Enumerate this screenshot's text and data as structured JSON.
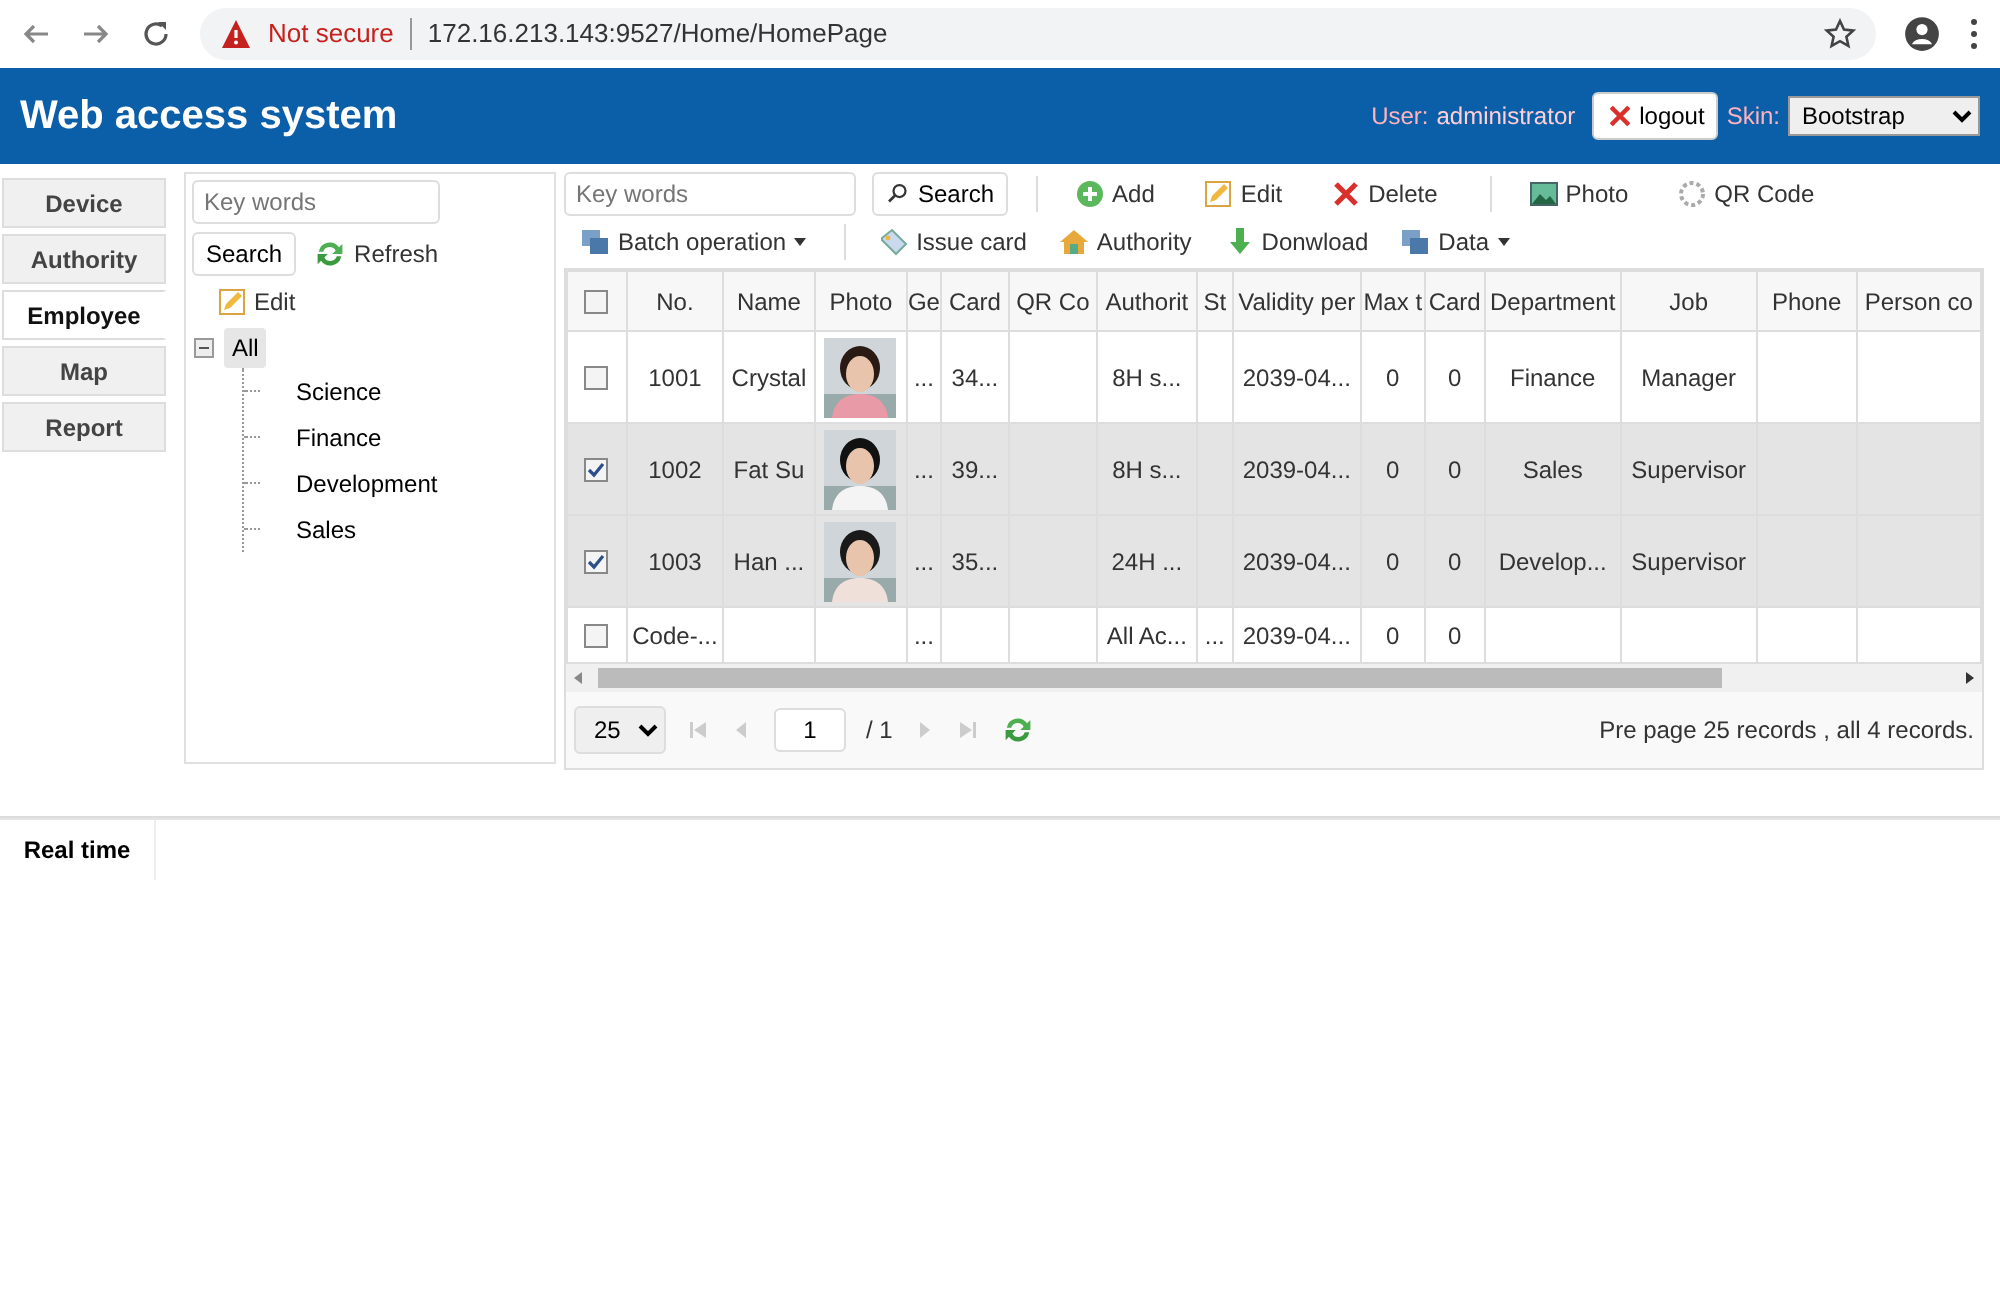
{
  "browser": {
    "security": "Not secure",
    "url": "172.16.213.143:9527/Home/HomePage"
  },
  "header": {
    "title": "Web access system",
    "user_label": "User:",
    "user": "administrator",
    "logout": "logout",
    "skin_label": "Skin:",
    "skin": "Bootstrap"
  },
  "nav_tabs": [
    {
      "label": "Device",
      "selected": false
    },
    {
      "label": "Authority",
      "selected": false
    },
    {
      "label": "Employee",
      "selected": true
    },
    {
      "label": "Map",
      "selected": false
    },
    {
      "label": "Report",
      "selected": false
    }
  ],
  "tree_panel": {
    "search": {
      "placeholder": "Key words"
    },
    "search_button": "Search",
    "refresh": "Refresh",
    "edit": "Edit",
    "tree": [
      {
        "label": "All",
        "expanded": true,
        "selected": true,
        "children": [
          {
            "label": "Science",
            "selected": false
          },
          {
            "label": "Finance",
            "selected": false
          },
          {
            "label": "Development",
            "selected": false
          },
          {
            "label": "Sales",
            "selected": false
          }
        ]
      }
    ]
  },
  "toolbar": {
    "search": {
      "placeholder": "Key words"
    },
    "search_button": "Search",
    "row_1": [
      {
        "label": "Add"
      },
      {
        "label": "Edit"
      },
      {
        "label": "Delete"
      },
      {
        "label": "Photo"
      },
      {
        "label": "QR Code"
      }
    ],
    "row_2": [
      {
        "label": "Batch operation",
        "dropdown": true
      },
      {
        "label": "Issue card",
        "dropdown": false
      },
      {
        "label": "Authority",
        "dropdown": false
      },
      {
        "label": "Donwload",
        "dropdown": false
      },
      {
        "label": "Data",
        "dropdown": true
      }
    ]
  },
  "table": {
    "all_selected": false,
    "columns": [
      "No.",
      "Name",
      "Photo",
      "Ge",
      "Card",
      "QR Co",
      "Authorit",
      "St",
      "Validity per",
      "Max t",
      "Card",
      "Department",
      "Job",
      "Phone",
      "Person co"
    ],
    "rows": [
      {
        "selected": false,
        "cells": [
          "1001",
          "Crystal",
          {
            "kind": "picture"
          },
          "...",
          "34...",
          "",
          "8H s...",
          "",
          "2039-04...",
          "0",
          "0",
          "Finance",
          "Manager",
          "",
          ""
        ]
      },
      {
        "selected": true,
        "cells": [
          "1002",
          "Fat Su",
          {
            "kind": "picture"
          },
          "...",
          "39...",
          "",
          "8H s...",
          "",
          "2039-04...",
          "0",
          "0",
          "Sales",
          "Supervisor",
          "",
          ""
        ]
      },
      {
        "selected": true,
        "cells": [
          "1003",
          "Han ...",
          {
            "kind": "picture"
          },
          "...",
          "35...",
          "",
          "24H ...",
          "",
          "2039-04...",
          "0",
          "0",
          "Develop...",
          "Supervisor",
          "",
          ""
        ]
      },
      {
        "selected": false,
        "cells": [
          "Code-...",
          "",
          "",
          "...",
          "",
          "",
          "All Ac...",
          "...",
          "2039-04...",
          "0",
          "0",
          "",
          "",
          "",
          ""
        ]
      }
    ]
  },
  "pager": {
    "page_size": "25",
    "page": "1",
    "total_pages": "/ 1",
    "summary": "Pre page 25 records , all 4 records."
  },
  "bottom_tabs": [
    {
      "label": "Real time",
      "selected": true
    }
  ]
}
